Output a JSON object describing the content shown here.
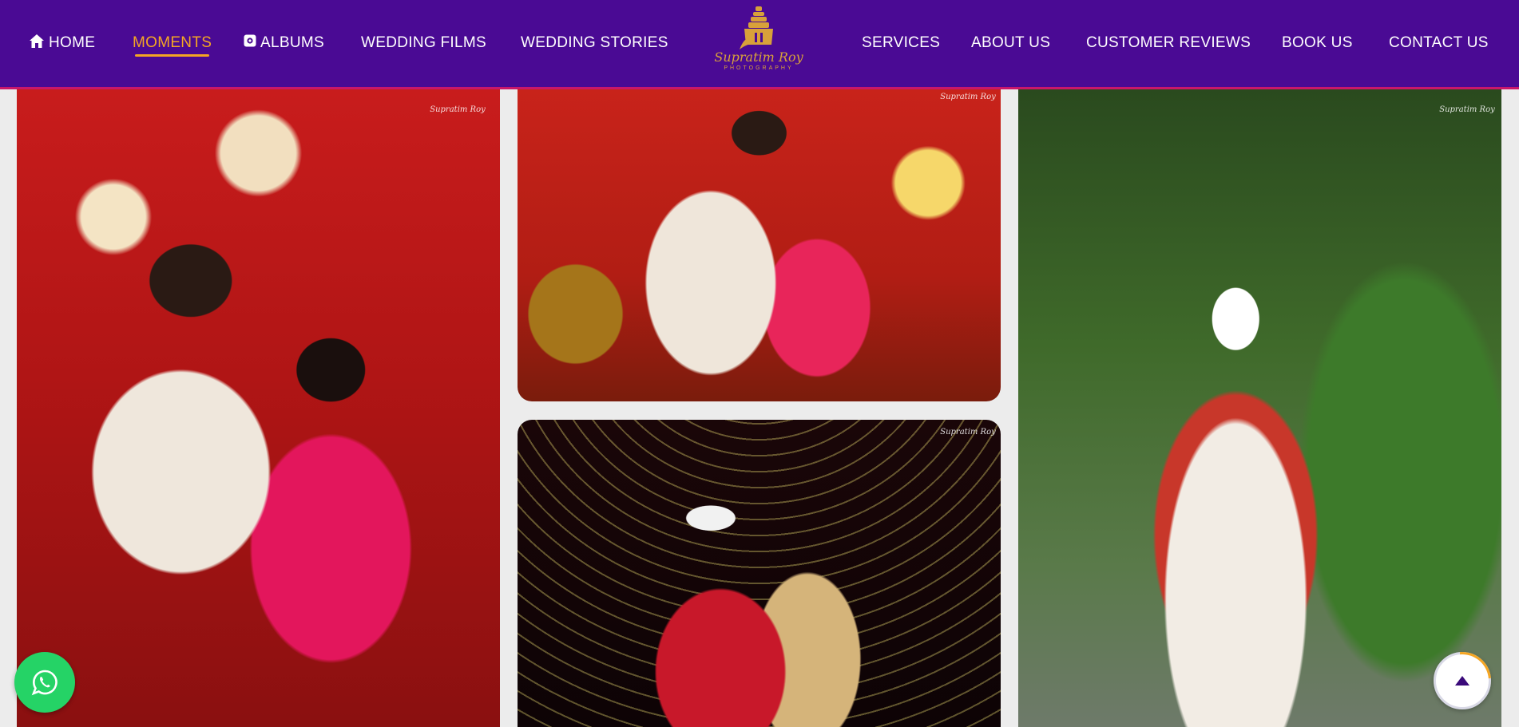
{
  "nav": {
    "home": "HOME",
    "moments": "MOMENTS",
    "albums": "ALBUMS",
    "wedding_films": "WEDDING FILMS",
    "wedding_stories": "WEDDING STORIES",
    "services": "SERVICES",
    "about_us": "ABOUT US",
    "customer_reviews": "CUSTOMER REVIEWS",
    "book_us": "BOOK US",
    "contact_us": "CONTACT US",
    "active": "MOMENTS"
  },
  "logo": {
    "name": "Supratim Roy",
    "subtitle": "PHOTOGRAPHY"
  },
  "watermark": "Supratim Roy",
  "colors": {
    "nav_bg": "#4a0a94",
    "nav_border": "#c9176b",
    "active": "#f5a623",
    "logo_gold": "#d8a13a",
    "whatsapp": "#25d366"
  },
  "icons": {
    "home": "home-icon",
    "albums": "album-icon",
    "whatsapp": "whatsapp-icon",
    "scroll_top": "arrow-up-icon"
  }
}
